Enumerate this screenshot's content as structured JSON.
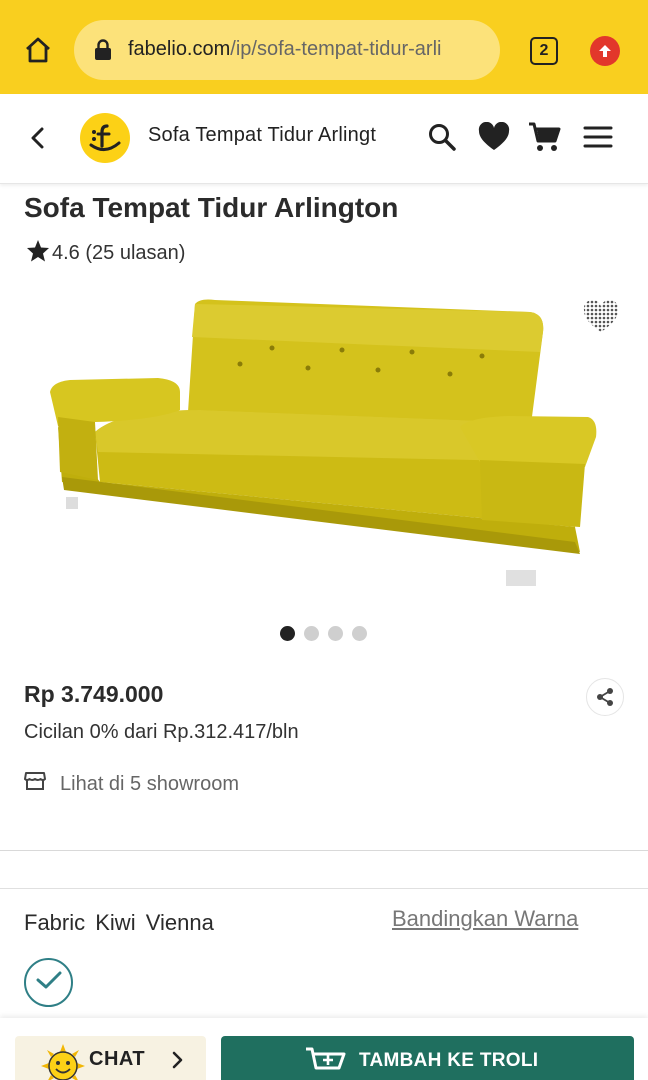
{
  "browser": {
    "url_host": "fabelio.com",
    "url_path": "/ip/sofa-tempat-tidur-arli",
    "tab_count": "2",
    "bar_color": "#f9cf1f"
  },
  "header": {
    "title": "Sofa Tempat Tidur Arlingt",
    "icons": [
      "back-icon",
      "fabelio-logo",
      "search-icon",
      "heart-icon",
      "cart-icon",
      "menu-icon"
    ]
  },
  "product": {
    "title": "Sofa Tempat Tidur Arlington",
    "rating": "4.6 (25 ulasan)",
    "image_count": 4,
    "active_image": 1,
    "price": "Rp 3.749.000",
    "installment": "Cicilan 0% dari Rp.312.417/bln",
    "showroom": "Lihat di 5 showroom",
    "sofa_color": "#d7c620"
  },
  "variant": {
    "fabric_label": "Fabric",
    "fabric_value": "Kiwi Vienna",
    "compare_link": "Bandingkan Warna",
    "selected_swatch_color": "#2f7f86"
  },
  "actions": {
    "chat_label": "CHAT",
    "add_to_cart_label": "TAMBAH KE TROLI",
    "cart_button_color": "#1f6f5f"
  }
}
